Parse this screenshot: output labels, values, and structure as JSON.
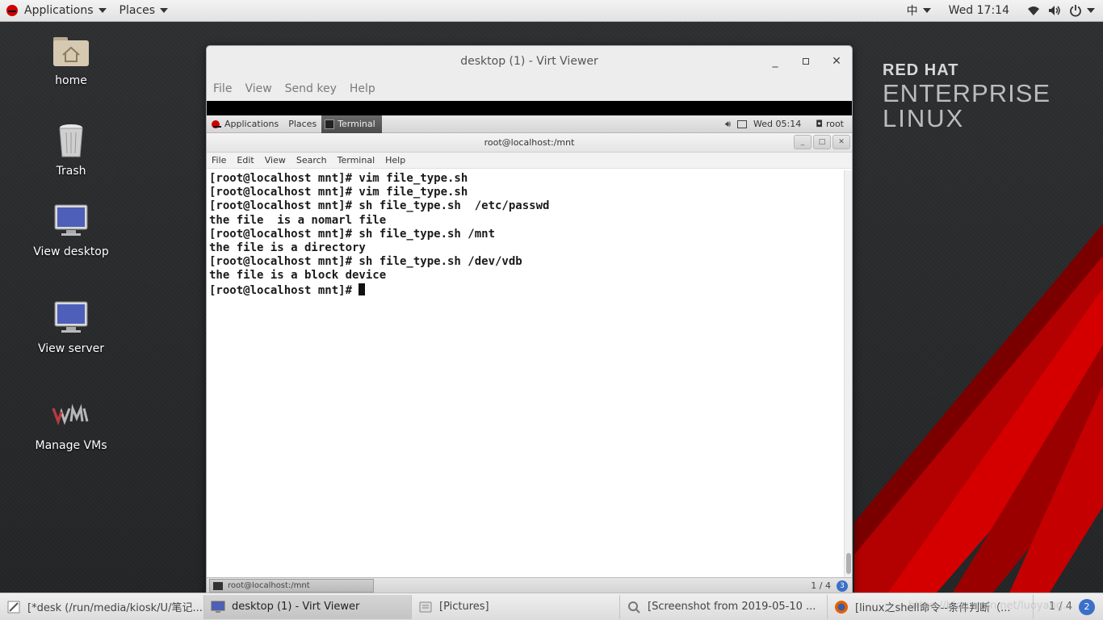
{
  "top_panel": {
    "applications": "Applications",
    "places": "Places",
    "input_method": "中",
    "clock": "Wed 17:14"
  },
  "brand": {
    "line1": "RED HAT",
    "line2": "ENTERPRISE",
    "line3": "LINUX"
  },
  "desktop_icons": [
    {
      "label": "home"
    },
    {
      "label": "Trash"
    },
    {
      "label": "View desktop"
    },
    {
      "label": "View server"
    },
    {
      "label": "Manage VMs"
    }
  ],
  "virt_viewer": {
    "title": "desktop (1) - Virt Viewer",
    "menu": [
      "File",
      "View",
      "Send key",
      "Help"
    ]
  },
  "guest_panel": {
    "applications": "Applications",
    "places": "Places",
    "terminal_tab": "Terminal",
    "clock": "Wed 05:14",
    "user": "root"
  },
  "terminal": {
    "title": "root@localhost:/mnt",
    "menu": [
      "File",
      "Edit",
      "View",
      "Search",
      "Terminal",
      "Help"
    ],
    "lines": [
      "[root@localhost mnt]# vim file_type.sh",
      "[root@localhost mnt]# vim file_type.sh",
      "[root@localhost mnt]# sh file_type.sh  /etc/passwd",
      "the file  is a nomarl file",
      "[root@localhost mnt]# sh file_type.sh /mnt",
      "the file is a directory",
      "[root@localhost mnt]# sh file_type.sh /dev/vdb",
      "the file is a block device"
    ],
    "prompt": "[root@localhost mnt]# "
  },
  "guest_bottom": {
    "task": "root@localhost:/mnt",
    "pager": "1 / 4",
    "badge": "3"
  },
  "taskbar": {
    "items": [
      "[*desk (/run/media/kiosk/U/笔记...",
      "desktop (1) - Virt Viewer",
      "[Pictures]",
      "[Screenshot from 2019-05-10 ...",
      "[linux之shell命令--条件判断（..."
    ],
    "pager": "1 / 4",
    "badge": "2",
    "watermark": "https://blog.csdn.net/luoyang..."
  }
}
